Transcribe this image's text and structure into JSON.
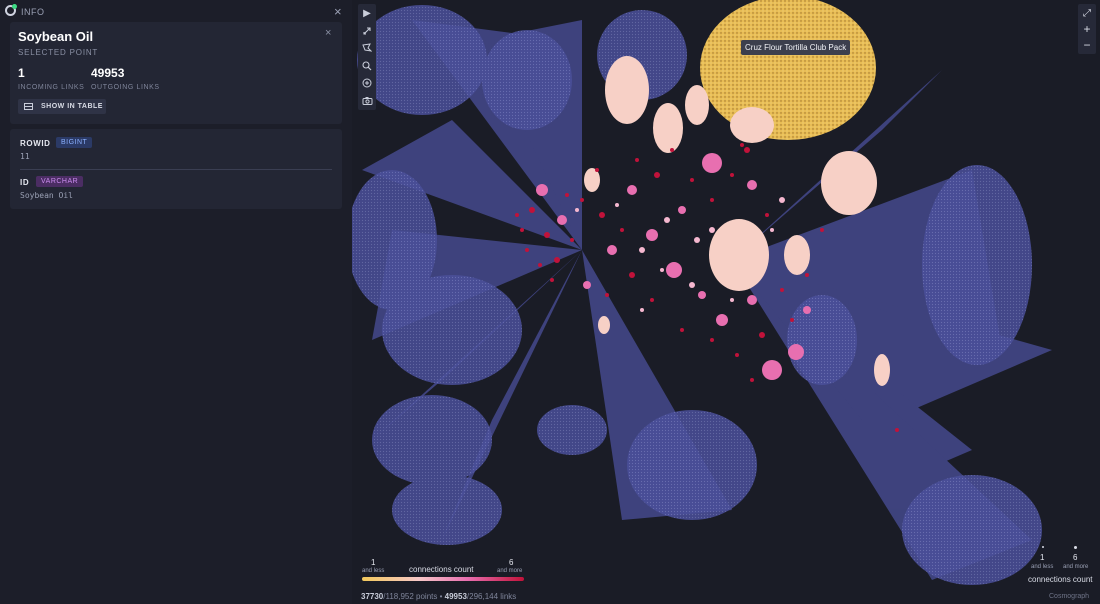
{
  "panel": {
    "title": "INFO",
    "close_icon": "×"
  },
  "selected": {
    "name": "Soybean Oil",
    "subtitle": "SELECTED POINT",
    "close_icon": "×",
    "incoming_value": "1",
    "incoming_label": "INCOMING LINKS",
    "outgoing_value": "49953",
    "outgoing_label": "OUTGOING LINKS",
    "table_button_label": "SHOW IN TABLE"
  },
  "properties": [
    {
      "name": "ROWID",
      "type": "BIGINT",
      "value": "11"
    },
    {
      "name": "ID",
      "type": "VARCHAR",
      "value": "Soybean Oil"
    }
  ],
  "toolbar": {
    "play_icon": "▶",
    "zoom_icon": "⌕",
    "add_icon": "⊕",
    "camera_icon": "◉"
  },
  "zoom_controls": {
    "fit_icon": "⤢",
    "plus": "+",
    "minus": "−"
  },
  "tooltip": {
    "text": "Cruz Flour Tortilla Club Pack"
  },
  "legend_color": {
    "min_value": "1",
    "min_sub": "and less",
    "title": "connections count",
    "max_value": "6",
    "max_sub": "and more",
    "gradient_colors": [
      "#f2c85b",
      "#f7c8c8",
      "#e86fb0",
      "#c1123a"
    ]
  },
  "legend_size": {
    "min_value": "1",
    "min_sub": "and less",
    "max_value": "6",
    "max_sub": "and more",
    "title": "connections count"
  },
  "status": {
    "points_shown": "37730",
    "points_total": "/118,952 points",
    "sep": "•",
    "links_shown": "49953",
    "links_total": "/296,144 links"
  },
  "brand": "Cosmograph",
  "colors": {
    "link": "#4a4f9a",
    "node_large": "#f7d0c6",
    "node_pink": "#e86fb0",
    "node_red": "#c1123a",
    "highlight": "#e8bd55"
  }
}
